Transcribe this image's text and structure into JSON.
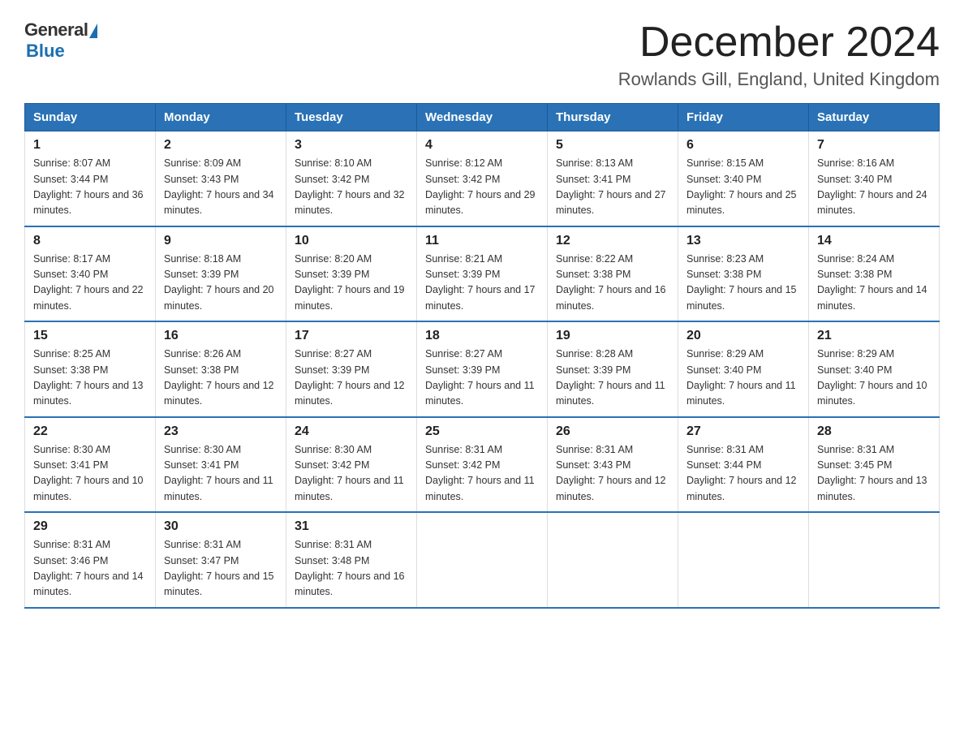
{
  "logo": {
    "general": "General",
    "blue": "Blue"
  },
  "title": "December 2024",
  "location": "Rowlands Gill, England, United Kingdom",
  "headers": [
    "Sunday",
    "Monday",
    "Tuesday",
    "Wednesday",
    "Thursday",
    "Friday",
    "Saturday"
  ],
  "weeks": [
    [
      {
        "day": "1",
        "sunrise": "8:07 AM",
        "sunset": "3:44 PM",
        "daylight": "7 hours and 36 minutes."
      },
      {
        "day": "2",
        "sunrise": "8:09 AM",
        "sunset": "3:43 PM",
        "daylight": "7 hours and 34 minutes."
      },
      {
        "day": "3",
        "sunrise": "8:10 AM",
        "sunset": "3:42 PM",
        "daylight": "7 hours and 32 minutes."
      },
      {
        "day": "4",
        "sunrise": "8:12 AM",
        "sunset": "3:42 PM",
        "daylight": "7 hours and 29 minutes."
      },
      {
        "day": "5",
        "sunrise": "8:13 AM",
        "sunset": "3:41 PM",
        "daylight": "7 hours and 27 minutes."
      },
      {
        "day": "6",
        "sunrise": "8:15 AM",
        "sunset": "3:40 PM",
        "daylight": "7 hours and 25 minutes."
      },
      {
        "day": "7",
        "sunrise": "8:16 AM",
        "sunset": "3:40 PM",
        "daylight": "7 hours and 24 minutes."
      }
    ],
    [
      {
        "day": "8",
        "sunrise": "8:17 AM",
        "sunset": "3:40 PM",
        "daylight": "7 hours and 22 minutes."
      },
      {
        "day": "9",
        "sunrise": "8:18 AM",
        "sunset": "3:39 PM",
        "daylight": "7 hours and 20 minutes."
      },
      {
        "day": "10",
        "sunrise": "8:20 AM",
        "sunset": "3:39 PM",
        "daylight": "7 hours and 19 minutes."
      },
      {
        "day": "11",
        "sunrise": "8:21 AM",
        "sunset": "3:39 PM",
        "daylight": "7 hours and 17 minutes."
      },
      {
        "day": "12",
        "sunrise": "8:22 AM",
        "sunset": "3:38 PM",
        "daylight": "7 hours and 16 minutes."
      },
      {
        "day": "13",
        "sunrise": "8:23 AM",
        "sunset": "3:38 PM",
        "daylight": "7 hours and 15 minutes."
      },
      {
        "day": "14",
        "sunrise": "8:24 AM",
        "sunset": "3:38 PM",
        "daylight": "7 hours and 14 minutes."
      }
    ],
    [
      {
        "day": "15",
        "sunrise": "8:25 AM",
        "sunset": "3:38 PM",
        "daylight": "7 hours and 13 minutes."
      },
      {
        "day": "16",
        "sunrise": "8:26 AM",
        "sunset": "3:38 PM",
        "daylight": "7 hours and 12 minutes."
      },
      {
        "day": "17",
        "sunrise": "8:27 AM",
        "sunset": "3:39 PM",
        "daylight": "7 hours and 12 minutes."
      },
      {
        "day": "18",
        "sunrise": "8:27 AM",
        "sunset": "3:39 PM",
        "daylight": "7 hours and 11 minutes."
      },
      {
        "day": "19",
        "sunrise": "8:28 AM",
        "sunset": "3:39 PM",
        "daylight": "7 hours and 11 minutes."
      },
      {
        "day": "20",
        "sunrise": "8:29 AM",
        "sunset": "3:40 PM",
        "daylight": "7 hours and 11 minutes."
      },
      {
        "day": "21",
        "sunrise": "8:29 AM",
        "sunset": "3:40 PM",
        "daylight": "7 hours and 10 minutes."
      }
    ],
    [
      {
        "day": "22",
        "sunrise": "8:30 AM",
        "sunset": "3:41 PM",
        "daylight": "7 hours and 10 minutes."
      },
      {
        "day": "23",
        "sunrise": "8:30 AM",
        "sunset": "3:41 PM",
        "daylight": "7 hours and 11 minutes."
      },
      {
        "day": "24",
        "sunrise": "8:30 AM",
        "sunset": "3:42 PM",
        "daylight": "7 hours and 11 minutes."
      },
      {
        "day": "25",
        "sunrise": "8:31 AM",
        "sunset": "3:42 PM",
        "daylight": "7 hours and 11 minutes."
      },
      {
        "day": "26",
        "sunrise": "8:31 AM",
        "sunset": "3:43 PM",
        "daylight": "7 hours and 12 minutes."
      },
      {
        "day": "27",
        "sunrise": "8:31 AM",
        "sunset": "3:44 PM",
        "daylight": "7 hours and 12 minutes."
      },
      {
        "day": "28",
        "sunrise": "8:31 AM",
        "sunset": "3:45 PM",
        "daylight": "7 hours and 13 minutes."
      }
    ],
    [
      {
        "day": "29",
        "sunrise": "8:31 AM",
        "sunset": "3:46 PM",
        "daylight": "7 hours and 14 minutes."
      },
      {
        "day": "30",
        "sunrise": "8:31 AM",
        "sunset": "3:47 PM",
        "daylight": "7 hours and 15 minutes."
      },
      {
        "day": "31",
        "sunrise": "8:31 AM",
        "sunset": "3:48 PM",
        "daylight": "7 hours and 16 minutes."
      },
      null,
      null,
      null,
      null
    ]
  ]
}
